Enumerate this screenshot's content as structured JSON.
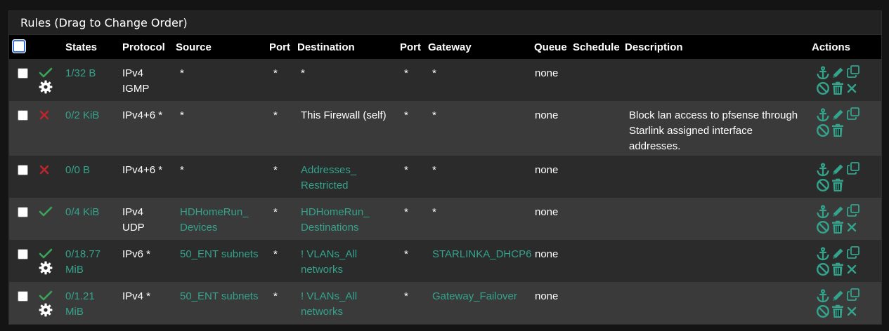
{
  "panel": {
    "title": "Rules (Drag to Change Order)"
  },
  "headers": {
    "states": "States",
    "protocol": "Protocol",
    "source": "Source",
    "port1": "Port",
    "destination": "Destination",
    "port2": "Port",
    "gateway": "Gateway",
    "queue": "Queue",
    "schedule": "Schedule",
    "description": "Description",
    "actions": "Actions"
  },
  "colors": {
    "teal": "#33a38c",
    "pass": "#3aa55a",
    "block": "#c0242b"
  },
  "rows": [
    {
      "status_icon": "check-icon",
      "has_gear": true,
      "states": "1/32 B",
      "protocol1": "IPv4",
      "protocol2": "IGMP",
      "source": "*",
      "source_link": false,
      "port1": "*",
      "dest1": "*",
      "dest2": "",
      "dest_link": false,
      "port2": "*",
      "gateway": "*",
      "gateway_link": false,
      "queue": "none",
      "desc1": "",
      "desc2": "",
      "desc3": "",
      "has_x": true
    },
    {
      "status_icon": "x-icon",
      "has_gear": false,
      "states": "0/2 KiB",
      "protocol1": "IPv4+6 *",
      "protocol2": "",
      "source": "*",
      "source_link": false,
      "port1": "*",
      "dest1": "This Firewall (self)",
      "dest2": "",
      "dest_link": false,
      "port2": "*",
      "gateway": "*",
      "gateway_link": false,
      "queue": "none",
      "desc1": "Block lan access to pfsense through",
      "desc2": "Starlink assigned interface",
      "desc3": "addresses.",
      "has_x": false
    },
    {
      "status_icon": "x-icon",
      "has_gear": false,
      "states": "0/0 B",
      "protocol1": "IPv4+6 *",
      "protocol2": "",
      "source": "*",
      "source_link": false,
      "port1": "*",
      "dest1": "Addresses_",
      "dest2": "Restricted",
      "dest_link": true,
      "port2": "*",
      "gateway": "*",
      "gateway_link": false,
      "queue": "none",
      "desc1": "",
      "desc2": "",
      "desc3": "",
      "has_x": false
    },
    {
      "status_icon": "check-icon",
      "has_gear": false,
      "states": "0/4 KiB",
      "protocol1": "IPv4",
      "protocol2": "UDP",
      "source": "HDHomeRun_",
      "source2": "Devices",
      "source_link": true,
      "port1": "*",
      "dest1": "HDHomeRun_",
      "dest2": "Destinations",
      "dest_link": true,
      "port2": "*",
      "gateway": "*",
      "gateway_link": false,
      "queue": "none",
      "desc1": "",
      "desc2": "",
      "desc3": "",
      "has_x": true
    },
    {
      "status_icon": "check-icon",
      "has_gear": true,
      "states": "0/18.77",
      "states2": "MiB",
      "protocol1": "IPv6 *",
      "protocol2": "",
      "source": "50_ENT subnets",
      "source_link": true,
      "port1": "*",
      "dest1": "! VLANs_All",
      "dest2": "networks",
      "dest_link": true,
      "port2": "*",
      "gateway": "STARLINKA_DHCP6",
      "gateway_link": true,
      "queue": "none",
      "desc1": "",
      "desc2": "",
      "desc3": "",
      "has_x": true
    },
    {
      "status_icon": "check-icon",
      "has_gear": true,
      "states": "0/1.21",
      "states2": "MiB",
      "protocol1": "IPv4 *",
      "protocol2": "",
      "source": "50_ENT subnets",
      "source_link": true,
      "port1": "*",
      "dest1": "! VLANs_All",
      "dest2": "networks",
      "dest_link": true,
      "port2": "*",
      "gateway": "Gateway_Failover",
      "gateway_link": true,
      "queue": "none",
      "desc1": "",
      "desc2": "",
      "desc3": "",
      "has_x": true
    }
  ]
}
